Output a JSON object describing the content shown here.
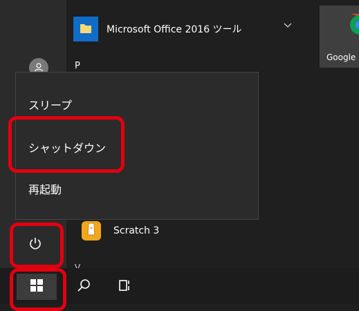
{
  "start_menu": {
    "apps": {
      "office_tools": "Microsoft Office 2016 ツール",
      "section_p": "P",
      "scratch": "Scratch 3",
      "section_v": "V"
    },
    "tile_google": "Google"
  },
  "power_menu": {
    "items": [
      "スリープ",
      "シャットダウン",
      "再起動"
    ]
  },
  "icons": {
    "user": "user-icon",
    "power": "power-icon",
    "start": "windows-logo-icon",
    "search": "search-icon",
    "task_view": "task-view-icon",
    "folder": "folder-icon",
    "expand": "chevron-down-icon"
  },
  "colors": {
    "highlight": "#e3000f",
    "menu_bg": "#2b2b2b",
    "taskbar_bg": "#1c1c1c",
    "office_icon_bg": "#0f6dc8",
    "scratch_icon_bg": "#f2a81b"
  }
}
